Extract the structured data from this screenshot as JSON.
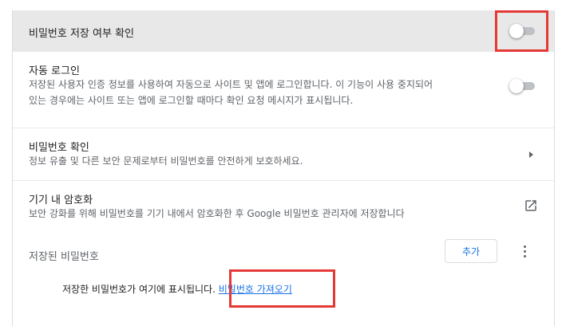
{
  "settings": {
    "offer_to_save": {
      "title": "비밀번호 저장 여부 확인",
      "enabled": false
    },
    "auto_sign_in": {
      "title": "자동 로그인",
      "description_line1": "저장된 사용자 인증 정보를 사용하여 자동으로 사이트 및 앱에 로그인합니다. 이 기능이 사용 중지되어",
      "description_line2": "있는 경우에는 사이트 또는 앱에 로그인할 때마다 확인 요청 메시지가 표시됩니다.",
      "enabled": false
    },
    "password_check": {
      "title": "비밀번호 확인",
      "description": "정보 유출 및 다른 보안 문제로부터 비밀번호를 안전하게 보호하세요.",
      "icon": "chevron-right-icon"
    },
    "on_device_encryption": {
      "title": "기기 내 암호화",
      "description": "보안 강화를 위해 비밀번호를 기기 내에서 암호화한 후 Google 비밀번호 관리자에 저장합니다",
      "icon": "open-in-new-icon"
    }
  },
  "saved_passwords": {
    "label": "저장된 비밀번호",
    "add_button": "추가",
    "more_icon": "more-vert-icon",
    "empty_message": "저장한 비밀번호가 여기에 표시됩니다.",
    "import_link": "비밀번호 가져오기"
  },
  "colors": {
    "highlight": "#e53935",
    "link": "#1a73e8",
    "toggle_off_track": "#bdc1c6"
  }
}
